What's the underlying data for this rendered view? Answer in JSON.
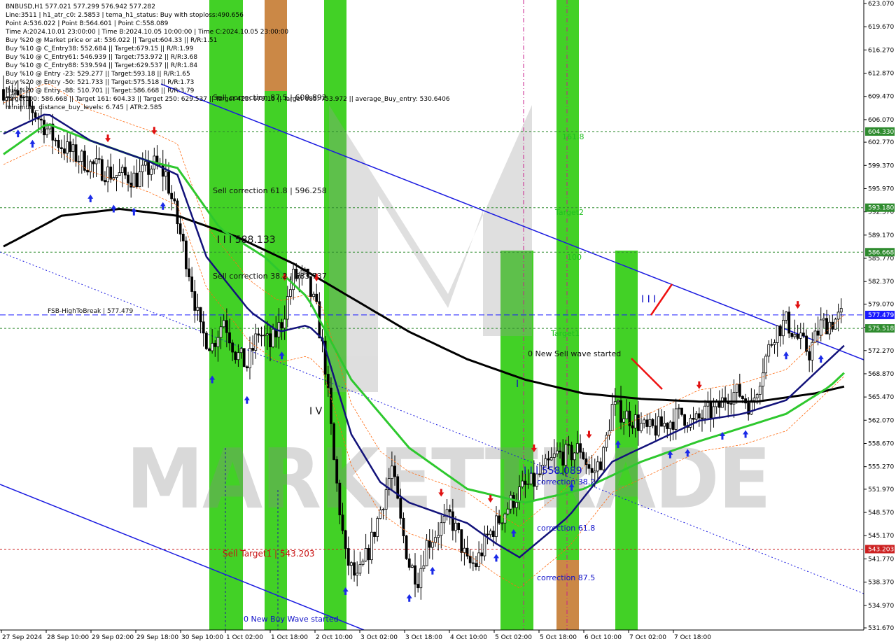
{
  "info_lines": [
    "BNBUSD,H1  577.021 577.299 576.942 577.282",
    "Line:3511  | h1_atr_c0: 2.5853  | tema_h1_status: Buy with stoploss:490.656",
    "Point A:536.022 | Point B:564.601 | Point C:558.089",
    "Time A:2024.10.01 23:00:00 | Time B:2024.10.05 10:00:00 | Time C:2024.10.05 23:00:00",
    "Buy %20 @ Market price or at: 536.022 || Target:604.33 || R/R:1.51",
    "Buy %10 @ C_Entry38: 552.684 || Target:679.15 || R/R:1.99",
    "Buy %10 @ C_Entry61: 546.939 || Target:753.972 || R/R:3.68",
    "Buy %10 @ C_Entry88: 539.594 || Target:629.537 || R/R:1.84",
    "Buy %10 @ Entry -23: 529.277 || Target:593.18 || R/R:1.65",
    "Buy %20 @ Entry -50: 521.733 || Target:575.518 || R/R:1.73",
    "Buy %20 @ Entry -88: 510.701 || Target:586.668 || R/R:3.79",
    "Target100: 586.668 || Target 161: 604.33 || Target 250: 629.537 || Target 423: 679.15 || Target 685: 753.972 || average_Buy_entry: 530.6406",
    "minimum_distance_buy_levels: 6.745 | ATR:2.585"
  ],
  "watermark": "MARKETTRADE",
  "chart_data": {
    "type": "candlestick",
    "symbol": "BNBUSD",
    "timeframe": "H1",
    "ylim": [
      531.67,
      623.07
    ],
    "y_ticks": [
      623.07,
      619.67,
      616.27,
      612.87,
      609.47,
      606.07,
      602.77,
      599.37,
      595.97,
      592.57,
      589.17,
      585.77,
      582.37,
      579.07,
      575.67,
      572.27,
      568.87,
      565.47,
      562.07,
      558.67,
      555.27,
      551.97,
      548.57,
      545.17,
      541.77,
      538.37,
      534.97,
      531.67
    ],
    "x_labels": [
      "27 Sep 2024",
      "28 Sep 10:00",
      "29 Sep 02:00",
      "29 Sep 18:00",
      "30 Sep 10:00",
      "1 Oct 02:00",
      "1 Oct 18:00",
      "2 Oct 10:00",
      "3 Oct 02:00",
      "3 Oct 18:00",
      "4 Oct 10:00",
      "5 Oct 02:00",
      "5 Oct 18:00",
      "6 Oct 10:00",
      "7 Oct 02:00",
      "7 Oct 18:00"
    ],
    "close_path": [
      [
        0,
        610.5
      ],
      [
        10,
        607.5
      ],
      [
        18,
        603
      ],
      [
        24,
        601
      ],
      [
        30,
        599.5
      ],
      [
        38,
        598
      ],
      [
        46,
        597.5
      ],
      [
        52,
        599.5
      ],
      [
        56,
        598
      ],
      [
        60,
        591
      ],
      [
        64,
        584
      ],
      [
        68,
        575
      ],
      [
        72,
        573
      ],
      [
        76,
        577
      ],
      [
        80,
        572
      ],
      [
        84,
        570
      ],
      [
        88,
        575
      ],
      [
        92,
        573
      ],
      [
        96,
        576.5
      ],
      [
        100,
        583
      ],
      [
        104,
        583
      ],
      [
        108,
        578
      ],
      [
        111,
        570
      ],
      [
        114,
        556
      ],
      [
        118,
        542
      ],
      [
        122,
        538.5
      ],
      [
        126,
        543
      ],
      [
        130,
        549
      ],
      [
        134,
        555
      ],
      [
        137,
        547
      ],
      [
        140,
        541
      ],
      [
        143,
        539
      ],
      [
        146,
        544
      ],
      [
        150,
        546
      ],
      [
        154,
        548
      ],
      [
        157,
        545
      ],
      [
        160,
        541
      ],
      [
        163,
        541
      ],
      [
        167,
        545
      ],
      [
        171,
        547.5
      ],
      [
        175,
        550
      ],
      [
        179,
        552
      ],
      [
        183,
        553
      ],
      [
        187,
        555
      ],
      [
        191,
        557
      ],
      [
        195,
        557
      ],
      [
        199,
        558
      ],
      [
        203,
        554
      ],
      [
        207,
        557
      ],
      [
        210,
        564
      ],
      [
        214,
        563
      ],
      [
        218,
        562
      ],
      [
        222,
        560.5
      ],
      [
        226,
        561
      ],
      [
        230,
        562
      ],
      [
        234,
        563
      ],
      [
        238,
        561.5
      ],
      [
        242,
        563
      ],
      [
        246,
        563.5
      ],
      [
        250,
        566
      ],
      [
        254,
        566
      ],
      [
        258,
        564
      ],
      [
        262,
        570
      ],
      [
        266,
        575
      ],
      [
        270,
        576.5
      ],
      [
        274,
        574
      ],
      [
        278,
        572
      ],
      [
        282,
        576
      ],
      [
        286,
        576.5
      ],
      [
        289,
        577.3
      ]
    ],
    "overlays": {
      "ema_black": [
        [
          0,
          587.5
        ],
        [
          20,
          592
        ],
        [
          40,
          593
        ],
        [
          60,
          592
        ],
        [
          80,
          589
        ],
        [
          100,
          585
        ],
        [
          120,
          580
        ],
        [
          140,
          575
        ],
        [
          160,
          571
        ],
        [
          180,
          568
        ],
        [
          200,
          566
        ],
        [
          220,
          565.2
        ],
        [
          240,
          564.8
        ],
        [
          260,
          564.8
        ],
        [
          280,
          566
        ],
        [
          290,
          567
        ]
      ],
      "ema_green": [
        [
          0,
          601
        ],
        [
          15,
          605.5
        ],
        [
          30,
          603
        ],
        [
          50,
          600
        ],
        [
          60,
          599
        ],
        [
          75,
          590
        ],
        [
          90,
          586
        ],
        [
          105,
          580
        ],
        [
          120,
          568
        ],
        [
          140,
          558
        ],
        [
          160,
          552
        ],
        [
          180,
          550
        ],
        [
          200,
          552
        ],
        [
          220,
          556
        ],
        [
          240,
          559
        ],
        [
          255,
          561
        ],
        [
          270,
          563
        ],
        [
          285,
          567
        ],
        [
          290,
          569
        ]
      ],
      "tema_navy": [
        [
          0,
          604
        ],
        [
          15,
          607
        ],
        [
          30,
          603
        ],
        [
          50,
          600
        ],
        [
          60,
          598
        ],
        [
          70,
          586
        ],
        [
          85,
          578
        ],
        [
          95,
          575
        ],
        [
          105,
          576
        ],
        [
          110,
          574
        ],
        [
          120,
          560
        ],
        [
          130,
          553
        ],
        [
          140,
          550
        ],
        [
          160,
          547
        ],
        [
          170,
          544
        ],
        [
          178,
          542
        ],
        [
          195,
          548
        ],
        [
          210,
          556
        ],
        [
          225,
          559
        ],
        [
          240,
          562
        ],
        [
          255,
          563
        ],
        [
          270,
          565
        ],
        [
          285,
          571
        ],
        [
          290,
          573
        ]
      ]
    },
    "sell_levels": [
      "Sell correction 87.5 | 609.892",
      "Sell correction 61.8 | 596.258",
      "Sell correction 38.2 | 583.737",
      "Sell Target1 | 543.203"
    ],
    "buy_levels": [
      "correction 38.2",
      "correction 61.8",
      "correction 87.5"
    ]
  },
  "levels": [
    {
      "label": "604.330",
      "value": 604.33,
      "color": "#2e8b2e"
    },
    {
      "label": "593.180",
      "value": 593.18,
      "color": "#2e8b2e"
    },
    {
      "label": "586.668",
      "value": 586.668,
      "color": "#2e8b2e"
    },
    {
      "label": "577.479",
      "value": 577.479,
      "color": "#1a1aff"
    },
    {
      "label": "575.518",
      "value": 575.518,
      "color": "#2e8b2e"
    },
    {
      "label": "543.203",
      "value": 543.203,
      "color": "#cc2020"
    }
  ],
  "annotations": {
    "fsb": "FSB-HighToBreak | 577.479",
    "sell_c875": "Sell correction 87.5 | 609.892",
    "sell_c618": "Sell correction 61.8 | 596.258",
    "sell_c382": "Sell correction 38.2 | 583.737",
    "sell_target1": "Sell Target1 | 543.203",
    "wave_iii_a": "I I I 588.133",
    "wave_iv": "I V",
    "wave_iii_b": "I I I 558.089",
    "wave_i": "I",
    "wave_iii_c": "I I I",
    "new_buy_wave": "0 New Buy Wave started",
    "new_sell_wave": "0 New Sell wave started",
    "t1618": "161.8",
    "target2": "Target2",
    "t100": "100",
    "target1": "Target1",
    "corr382": "correction 38.2",
    "corr618": "correction 61.8",
    "corr875": "correction 87.5"
  }
}
